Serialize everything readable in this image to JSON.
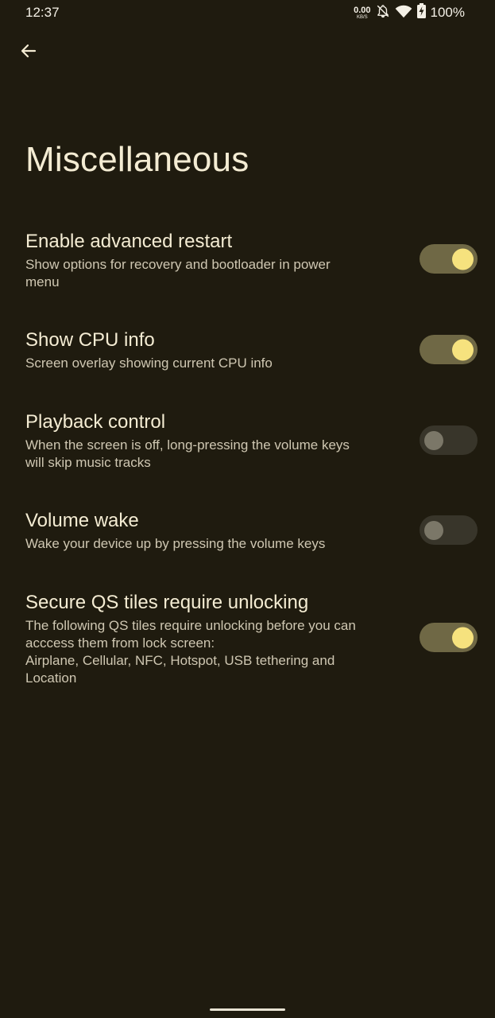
{
  "status_bar": {
    "time": "12:37",
    "net_speed_value": "0.00",
    "net_speed_unit": "KB/S",
    "battery_percent": "100%",
    "icons": [
      "notifications-off-icon",
      "wifi-icon",
      "battery-charging-icon"
    ]
  },
  "header": {
    "back_icon": "arrow-back-icon",
    "title": "Miscellaneous"
  },
  "settings": [
    {
      "title": "Enable advanced restart",
      "summary": "Show options for recovery and bootloader in power\nmenu",
      "enabled": true
    },
    {
      "title": "Show CPU info",
      "summary": "Screen overlay showing current CPU info",
      "enabled": true
    },
    {
      "title": "Playback control",
      "summary": "When the screen is off, long-pressing the volume keys\nwill skip music tracks",
      "enabled": false
    },
    {
      "title": "Volume wake",
      "summary": "Wake your device up by pressing the volume keys",
      "enabled": false
    },
    {
      "title": "Secure QS tiles require unlocking",
      "summary": "The following QS tiles require unlocking before you can\nacccess them from lock screen:\nAirplane, Cellular, NFC, Hotspot, USB tethering and\nLocation",
      "enabled": true
    }
  ],
  "colors": {
    "background": "#1f1b0f",
    "toggle_on_track": "#6f6845",
    "toggle_on_thumb": "#f6e27e",
    "toggle_off_track": "#38352a",
    "toggle_off_thumb": "#7b7768"
  }
}
